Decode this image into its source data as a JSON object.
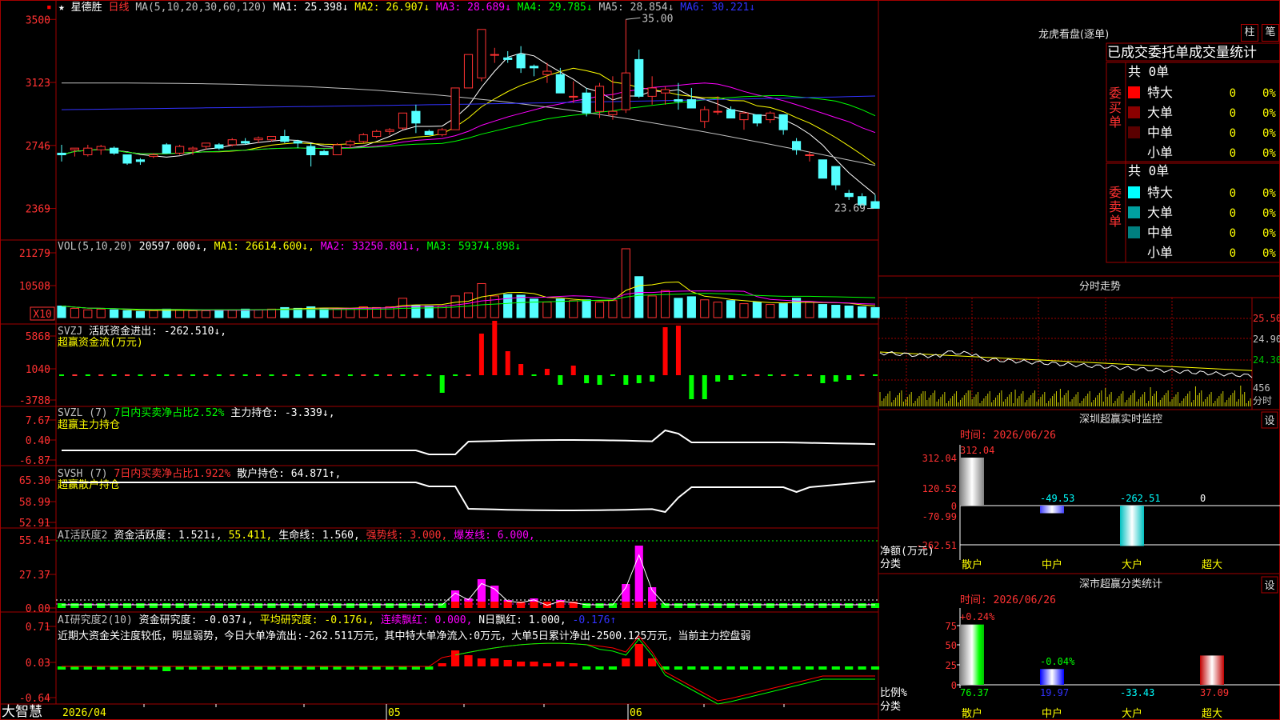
{
  "stock": {
    "name": "星德胜",
    "period": "日线",
    "star": "★",
    "flag_char": "▪"
  },
  "colors": {
    "up": "#ff3232",
    "down": "#54ffff",
    "ma1": "#ffffff",
    "ma2": "#ffff00",
    "ma3": "#ff00ff",
    "ma4": "#00ff00",
    "ma5": "#c0c0c0",
    "ma6": "#3232ff",
    "grid": "#a00000",
    "label": "#ff3232"
  },
  "header": {
    "price_ind": {
      "name": "MA(5,10,20,30,60,120)",
      "items": [
        {
          "label": "MA1:",
          "value": "25.398",
          "arrow": "↓"
        },
        {
          "label": "MA2:",
          "value": "26.907",
          "arrow": "↓"
        },
        {
          "label": "MA3:",
          "value": "28.689",
          "arrow": "↓"
        },
        {
          "label": "MA4:",
          "value": "29.785",
          "arrow": "↓"
        },
        {
          "label": "MA5:",
          "value": "28.854",
          "arrow": "↓"
        },
        {
          "label": "MA6:",
          "value": "30.221",
          "arrow": "↓"
        }
      ]
    },
    "vol_ind": {
      "name": "VOL(5,10,20)",
      "value": "20597.000",
      "arrow": "↓",
      "items": [
        {
          "label": "MA1:",
          "value": "26614.600",
          "arrow": "↓"
        },
        {
          "label": "MA2:",
          "value": "33250.801",
          "arrow": "↓"
        },
        {
          "label": "MA3:",
          "value": "59374.898",
          "arrow": "↓"
        }
      ]
    },
    "svzj": {
      "name": "SVZJ",
      "label": "活跃资金进出:",
      "value": "-262.510",
      "arrow": "↓",
      "sub": "超赢资金流(万元)"
    },
    "svzl": {
      "name": "SVZL (7)",
      "note": "7日内买卖净占比2.52%",
      "label": "主力持仓:",
      "value": "-3.339",
      "arrow": "↓",
      "sub": "超赢主力持仓"
    },
    "svsh": {
      "name": "SVSH (7)",
      "note": "7日内买卖净占比1.922%",
      "label": "散户持仓:",
      "value": "64.871",
      "arrow": "↑",
      "sub": "超赢散户持仓"
    },
    "ai_active": {
      "name": "AI活跃度2",
      "label": "资金活跃度:",
      "value": "1.521",
      "arrow": "↓",
      "v2": "55.411",
      "l3": "生命线:",
      "v3": "1.560",
      "l4": "强势线:",
      "v4": "3.000",
      "l5": "爆发线:",
      "v5": "6.000"
    },
    "ai_research": {
      "name": "AI研究度2(10)",
      "label": "资金研究度:",
      "value": "-0.037",
      "arrow": "↓",
      "l2": "平均研究度:",
      "v2": "-0.176",
      "l3": "连续飘红:",
      "v3": "0.000",
      "l4": "N日飘红:",
      "v4": "1.000",
      "v5": "-0.176",
      "comment": "近期大资金关注度较低，明显弱势，今日大单净流出:-262.511万元，其中特大单净流入:0万元，大单5日累计净出-2500.125万元，当前主力控盘弱"
    }
  },
  "axes": {
    "price": [
      "3500",
      "3123",
      "2746",
      "2369"
    ],
    "vol": [
      "21279",
      "10508"
    ],
    "vol_unit": "X10",
    "svzj": [
      "5868",
      "1040",
      "-3788"
    ],
    "svzl": [
      "7.67",
      "0.40",
      "-6.87"
    ],
    "svsh": [
      "65.30",
      "58.99",
      "52.91"
    ],
    "ai_active": [
      "55.41",
      "27.37",
      "0.00"
    ],
    "ai_research": [
      "0.71",
      "0.03",
      "-0.64"
    ]
  },
  "price_marks": {
    "high": "35.00",
    "low": "23.69"
  },
  "date_labels": [
    "2026/04",
    "05",
    "06"
  ],
  "brand": "大智慧",
  "lhb": {
    "title": "龙虎看盘(逐单)",
    "btn1": "柱",
    "btn2": "笔",
    "tabs": "已成交委托单成交量统计",
    "buy": {
      "side": "委买单",
      "total": "共 0单",
      "rows": [
        {
          "label": "特大",
          "count": "0",
          "pct": "0%",
          "color": "#ff0000"
        },
        {
          "label": "大单",
          "count": "0",
          "pct": "0%",
          "color": "#8b0000"
        },
        {
          "label": "中单",
          "count": "0",
          "pct": "0%",
          "color": "#5a0000"
        },
        {
          "label": "小单",
          "count": "0",
          "pct": "0%",
          "color": "#000000"
        }
      ]
    },
    "sell": {
      "side": "委卖单",
      "total": "共 0单",
      "rows": [
        {
          "label": "特大",
          "count": "0",
          "pct": "0%",
          "color": "#00ffff"
        },
        {
          "label": "大单",
          "count": "0",
          "pct": "0%",
          "color": "#00a0a0"
        },
        {
          "label": "中单",
          "count": "0",
          "pct": "0%",
          "color": "#008080"
        },
        {
          "label": "小单",
          "count": "0",
          "pct": "0%",
          "color": "#000000"
        }
      ]
    }
  },
  "intraday": {
    "title": "分时走势",
    "prices": [
      "25.50",
      "24.90",
      "24.30"
    ],
    "vol": "456",
    "unit": "分时"
  },
  "sz_monitor": {
    "title": "深圳超赢实时监控",
    "btn": "设",
    "date": "时间: 2026/06/26",
    "ticks": [
      "312.04",
      "120.52",
      "0",
      "-70.99",
      "-262.51"
    ],
    "ylabel": "净额(万元)",
    "xlabel": "分类",
    "bars": [
      {
        "cat": "散户",
        "value": 312.04,
        "label": "312.04"
      },
      {
        "cat": "中户",
        "value": -49.53,
        "label": "-49.53"
      },
      {
        "cat": "大户",
        "value": -262.51,
        "label": "-262.51"
      },
      {
        "cat": "超大",
        "value": 0,
        "label": "0"
      }
    ]
  },
  "sz_class": {
    "title": "深市超赢分类统计",
    "btn": "设",
    "date": "时间: 2026/06/26",
    "ticks": [
      "75",
      "50",
      "25",
      "0"
    ],
    "ylabel": "比例%",
    "xlabel": "分类",
    "top_labels": [
      "+0.24%",
      "-0.04%"
    ],
    "bars": [
      {
        "cat": "散户",
        "value": 76.37,
        "label": "76.37"
      },
      {
        "cat": "中户",
        "value": 19.97,
        "label": "19.97"
      },
      {
        "cat": "大户",
        "value": -33.43,
        "label": "-33.43"
      },
      {
        "cat": "超大",
        "value": 37.09,
        "label": "37.09"
      }
    ]
  },
  "chart_data": {
    "type": "candlestick",
    "ylim": [
      23.0,
      35.3
    ],
    "candles": [
      [
        27.0,
        27.5,
        26.5,
        26.9
      ],
      [
        27.2,
        27.3,
        26.8,
        27.3
      ],
      [
        26.9,
        27.5,
        26.8,
        27.3
      ],
      [
        27.2,
        27.5,
        26.9,
        27.4
      ],
      [
        27.3,
        27.4,
        26.9,
        27.0
      ],
      [
        26.9,
        26.9,
        26.3,
        26.4
      ],
      [
        26.6,
        26.7,
        26.3,
        26.5
      ],
      [
        26.8,
        27.0,
        26.7,
        26.9
      ],
      [
        27.5,
        27.6,
        27.0,
        27.0
      ],
      [
        27.0,
        27.5,
        26.9,
        27.4
      ],
      [
        27.2,
        27.4,
        26.9,
        27.3
      ],
      [
        27.4,
        27.6,
        27.2,
        27.6
      ],
      [
        27.5,
        27.6,
        27.2,
        27.3
      ],
      [
        27.5,
        27.9,
        27.4,
        27.8
      ],
      [
        27.7,
        27.9,
        27.5,
        27.6
      ],
      [
        27.8,
        28.0,
        27.6,
        27.9
      ],
      [
        27.8,
        28.0,
        27.7,
        28.0
      ],
      [
        28.0,
        28.4,
        27.6,
        27.7
      ],
      [
        27.7,
        27.8,
        27.3,
        27.6
      ],
      [
        27.4,
        27.6,
        26.2,
        26.9
      ],
      [
        27.1,
        27.2,
        26.9,
        26.9
      ],
      [
        26.9,
        27.6,
        26.9,
        27.5
      ],
      [
        27.5,
        27.8,
        27.3,
        27.7
      ],
      [
        27.7,
        28.2,
        27.6,
        28.1
      ],
      [
        28.0,
        28.4,
        27.9,
        28.3
      ],
      [
        28.3,
        28.5,
        28.1,
        28.4
      ],
      [
        28.5,
        29.4,
        28.4,
        29.4
      ],
      [
        29.5,
        29.9,
        28.2,
        28.8
      ],
      [
        28.3,
        28.4,
        28.1,
        28.1
      ],
      [
        28.1,
        28.5,
        28.0,
        28.4
      ],
      [
        28.4,
        30.9,
        28.4,
        30.9
      ],
      [
        30.9,
        32.9,
        30.9,
        32.9
      ],
      [
        31.5,
        34.4,
        31.3,
        34.4
      ],
      [
        32.9,
        33.3,
        32.4,
        32.9
      ],
      [
        32.7,
        33.1,
        32.4,
        32.6
      ],
      [
        32.9,
        33.4,
        31.8,
        32.1
      ],
      [
        32.2,
        32.3,
        31.6,
        32.1
      ],
      [
        31.7,
        32.4,
        31.2,
        31.9
      ],
      [
        31.7,
        32.1,
        30.6,
        30.6
      ],
      [
        30.4,
        31.3,
        30.0,
        30.4
      ],
      [
        30.6,
        30.9,
        29.2,
        29.4
      ],
      [
        29.5,
        31.2,
        29.1,
        31.0
      ],
      [
        29.3,
        31.6,
        29.0,
        29.5
      ],
      [
        29.6,
        35.0,
        29.4,
        31.8
      ],
      [
        32.6,
        33.2,
        30.3,
        30.4
      ],
      [
        30.4,
        31.6,
        29.9,
        30.9
      ],
      [
        30.6,
        31.0,
        29.9,
        30.8
      ],
      [
        30.2,
        31.2,
        29.6,
        30.1
      ],
      [
        30.2,
        30.9,
        29.7,
        29.7
      ],
      [
        28.9,
        29.8,
        28.5,
        29.6
      ],
      [
        29.5,
        30.4,
        29.3,
        29.5
      ],
      [
        29.6,
        29.8,
        29.1,
        29.1
      ],
      [
        29.0,
        29.5,
        28.4,
        29.4
      ],
      [
        29.3,
        29.3,
        28.6,
        28.8
      ],
      [
        29.0,
        29.5,
        28.8,
        29.4
      ],
      [
        29.3,
        29.3,
        28.1,
        28.4
      ],
      [
        27.7,
        27.9,
        26.9,
        27.2
      ],
      [
        26.9,
        27.1,
        26.5,
        26.9
      ],
      [
        26.6,
        26.6,
        25.5,
        25.5
      ],
      [
        26.2,
        26.2,
        24.8,
        25.1
      ],
      [
        24.6,
        24.8,
        24.2,
        24.4
      ],
      [
        24.4,
        24.6,
        23.9,
        23.9
      ],
      [
        24.1,
        24.5,
        23.7,
        23.7
      ]
    ],
    "volume": [
      1500,
      1200,
      1000,
      1100,
      1000,
      900,
      800,
      900,
      1100,
      1000,
      900,
      900,
      1000,
      1000,
      1100,
      1000,
      1100,
      1300,
      1200,
      1400,
      1200,
      1100,
      1200,
      1400,
      1300,
      1400,
      2500,
      1600,
      1500,
      1500,
      2800,
      3200,
      4400,
      2800,
      3000,
      2900,
      2400,
      2000,
      2400,
      2200,
      2300,
      2000,
      2200,
      8900,
      5300,
      2800,
      3500,
      2500,
      2700,
      2300,
      2000,
      2200,
      1800,
      2000,
      1700,
      1800,
      2500,
      2000,
      1700,
      1600,
      1500,
      1400,
      1300
    ]
  }
}
